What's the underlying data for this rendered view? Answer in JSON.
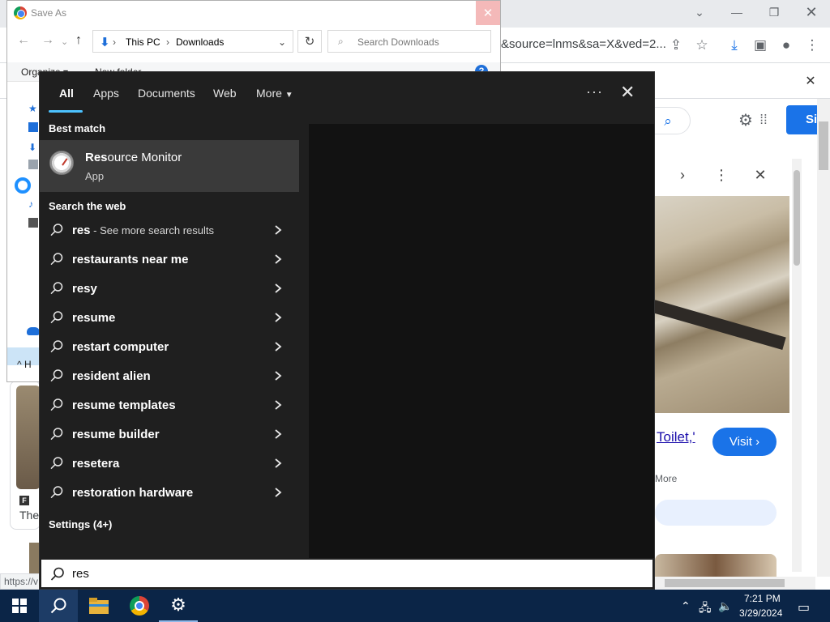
{
  "chrome": {
    "url_fragment": "&source=lnms&sa=X&ved=2...",
    "signin_label": "Si",
    "toilet_link": "Toilet,'",
    "visit_label": "Visit",
    "more_label": "More",
    "left_card_letter": "F",
    "left_card_the": "The",
    "status_url": "https://v"
  },
  "saveas": {
    "title": "Save As",
    "path": [
      "This PC",
      "Downloads"
    ],
    "search_placeholder": "Search Downloads",
    "organize": "Organize ▾",
    "new_folder": "New folder",
    "help": "?",
    "hide_folders": "H"
  },
  "flyout": {
    "tabs": [
      "All",
      "Apps",
      "Documents",
      "Web",
      "More"
    ],
    "best_match_header": "Best match",
    "best_match": {
      "name_bold": "Res",
      "name_rest": "ource Monitor",
      "type": "App"
    },
    "web_header": "Search the web",
    "suggestions": [
      {
        "bold": "res",
        "rest": "",
        "extra": " - See more search results"
      },
      {
        "bold": "res",
        "rest": "taurants near me",
        "extra": ""
      },
      {
        "bold": "res",
        "rest": "y",
        "extra": ""
      },
      {
        "bold": "res",
        "rest": "ume",
        "extra": ""
      },
      {
        "bold": "res",
        "rest": "tart computer",
        "extra": ""
      },
      {
        "bold": "res",
        "rest": "ident alien",
        "extra": ""
      },
      {
        "bold": "res",
        "rest": "ume templates",
        "extra": ""
      },
      {
        "bold": "res",
        "rest": "ume builder",
        "extra": ""
      },
      {
        "bold": "res",
        "rest": "etera",
        "extra": ""
      },
      {
        "bold": "res",
        "rest": "toration hardware",
        "extra": ""
      }
    ],
    "settings_header": "Settings (4+)",
    "search_value": "res"
  },
  "taskbar": {
    "time": "7:21 PM",
    "date": "3/29/2024"
  },
  "colors": {
    "flyout_bg": "#1f1f1f",
    "accent_underline": "#4cc2ff",
    "taskbar": "#0b2547",
    "google_blue": "#1a73e8"
  }
}
